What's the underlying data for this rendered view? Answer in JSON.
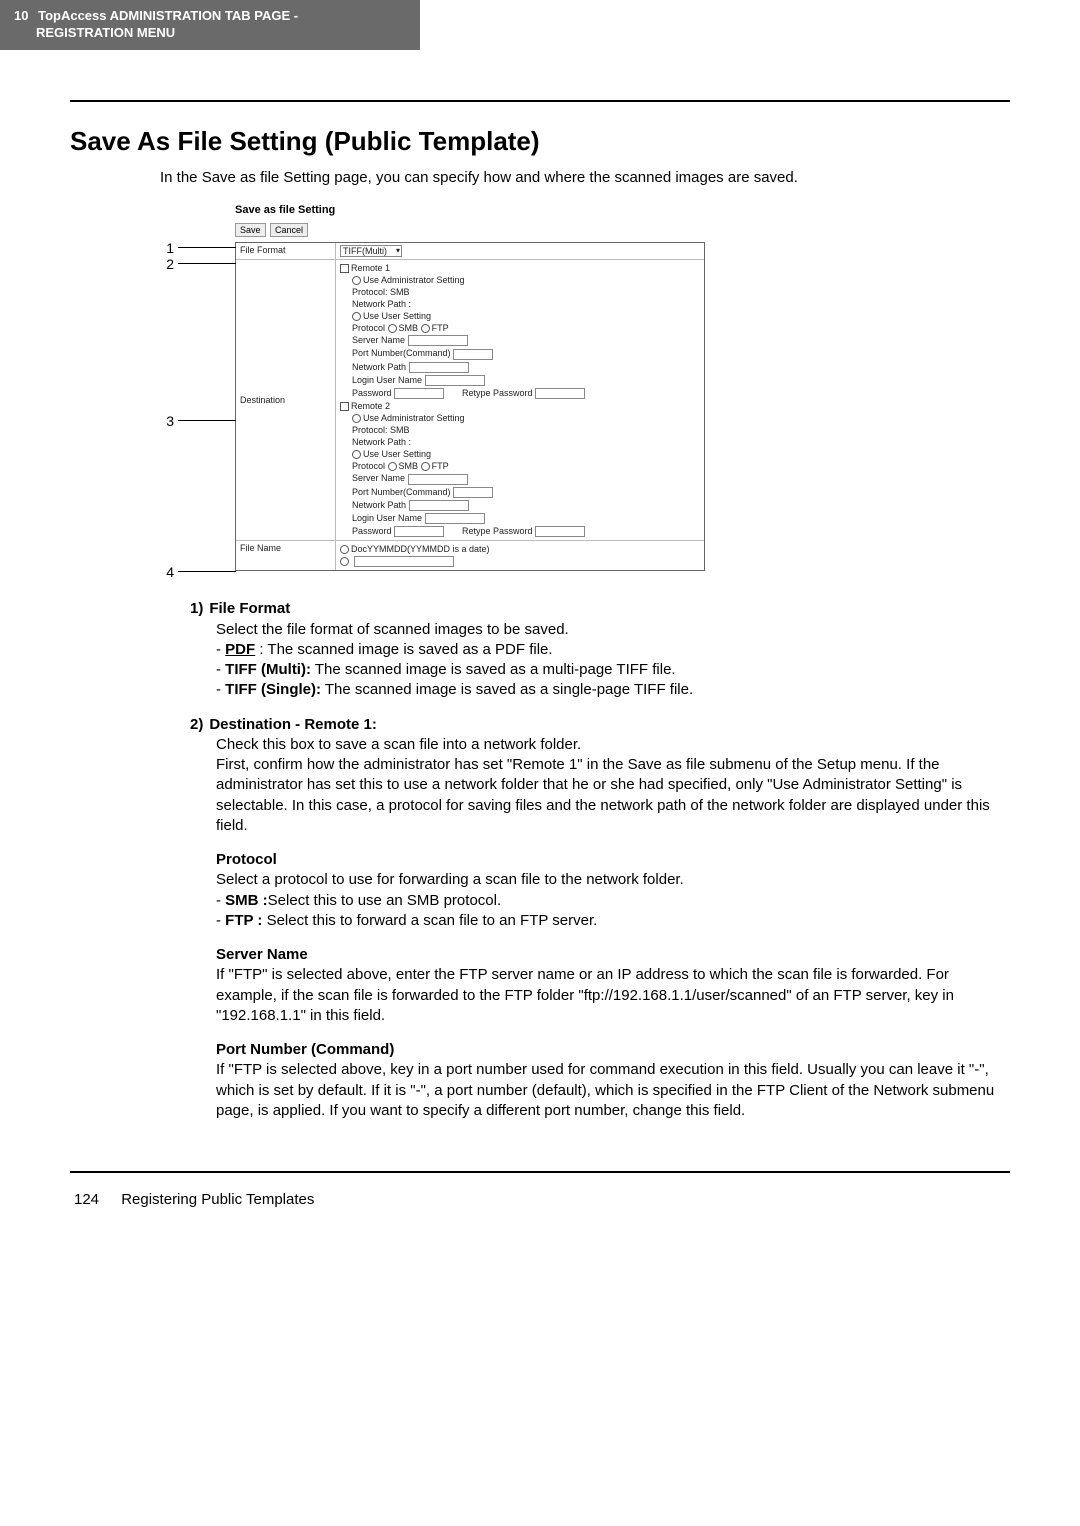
{
  "header": {
    "chapter": "10",
    "title_line1": "TopAccess ADMINISTRATION TAB PAGE -",
    "title_line2": "REGISTRATION MENU"
  },
  "section_title": "Save As File Setting (Public Template)",
  "intro": "In the Save as file Setting page, you can specify how and where the scanned images are saved.",
  "figure": {
    "caption": "Save as file Setting",
    "btn_save": "Save",
    "btn_cancel": "Cancel",
    "row_file_format": "File Format",
    "file_format_value": "TIFF(Multi)",
    "row_destination": "Destination",
    "remote1_label": "Remote 1",
    "remote2_label": "Remote 2",
    "use_admin": "Use Administrator Setting",
    "protocol_smb": "Protocol: SMB",
    "network_path_ro": "Network Path :",
    "use_user": "Use User Setting",
    "protocol_label": "Protocol",
    "smb": "SMB",
    "ftp": "FTP",
    "server_name": "Server Name",
    "port_cmd": "Port Number(Command)",
    "port_val": "-",
    "network_path": "Network Path",
    "login_user": "Login User Name",
    "password": "Password",
    "retype": "Retype Password",
    "row_file_name": "File Name",
    "filename_opt": "DocYYMMDD(YYMMDD is a date)"
  },
  "callouts": {
    "c1": "1",
    "c2": "2",
    "c3": "3",
    "c4": "4"
  },
  "defs": {
    "i1": {
      "num": "1)",
      "label": "File Format",
      "lead": "Select the file format of scanned images to be saved.",
      "b1_term": "PDF",
      "b1_sep": " : ",
      "b1_rest": "The scanned image is saved as a PDF file.",
      "b2_term": "TIFF (Multi):",
      "b2_rest": " The scanned image is saved as a multi-page TIFF file.",
      "b3_term": "TIFF (Single):",
      "b3_rest": " The scanned image is saved as a single-page TIFF file."
    },
    "i2": {
      "num": "2)",
      "label": "Destination - Remote 1:",
      "p1": "Check this box to save a scan file into a network folder.",
      "p2": "First, confirm how the administrator has set \"Remote 1\" in the Save as file submenu of the Setup menu. If the administrator has set this to use a network folder that he or she had specified, only \"Use Administrator Setting\" is selectable. In this case, a protocol for saving files and the network path of the network folder are displayed under this field.",
      "protocol_head": "Protocol",
      "protocol_lead": "Select a protocol to use for forwarding a scan file to the network folder.",
      "pb1_term": "SMB :",
      "pb1_rest": "Select this to use an SMB protocol.",
      "pb2_term": "FTP :",
      "pb2_rest": " Select this to forward a scan file to an FTP server.",
      "server_head": "Server Name",
      "server_body": "If \"FTP\" is selected above, enter the FTP server name or an IP address to which the scan file is forwarded. For example, if the scan file is forwarded to the FTP folder \"ftp://192.168.1.1/user/scanned\" of an FTP server, key in \"192.168.1.1\" in this field.",
      "port_head": "Port Number (Command)",
      "port_body": "If \"FTP is selected above, key in a port number used for command execution in this field. Usually you can leave it \"-\", which is set by default. If it is \"-\", a port number (default), which is specified in the FTP Client of the Network submenu page, is applied. If you want to specify a different port number, change this field."
    }
  },
  "footer": {
    "page": "124",
    "title": "Registering Public Templates"
  }
}
